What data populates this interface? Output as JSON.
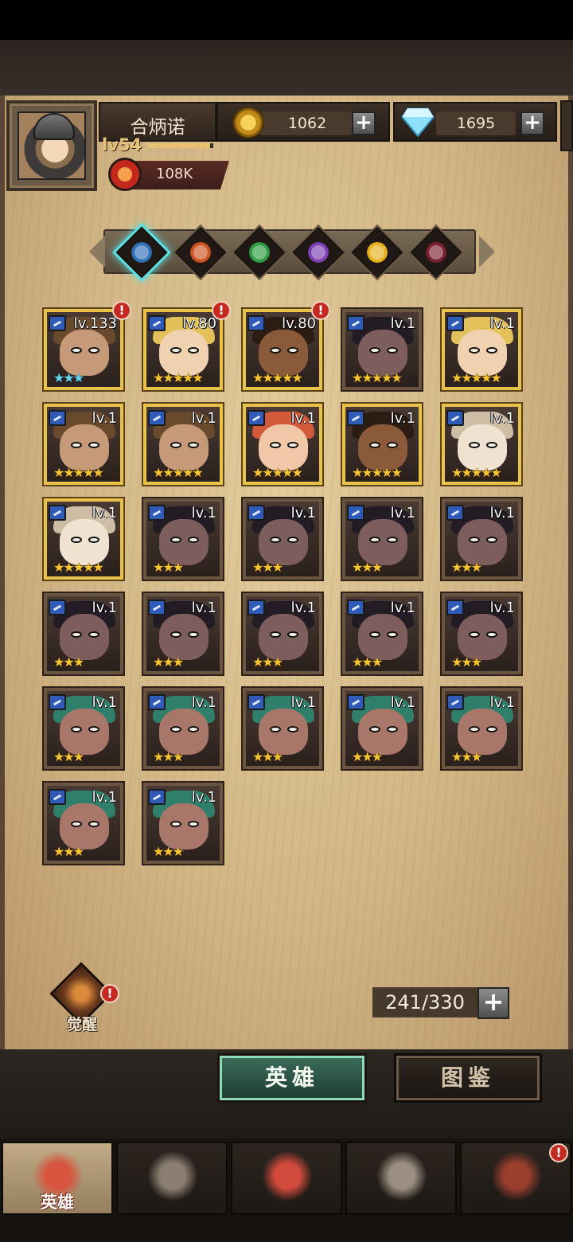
{
  "player": {
    "name": "合炳诺",
    "level": "lv54",
    "xp_fraction": 0.95,
    "power": "108K"
  },
  "resources": {
    "gold": "1062",
    "gems": "1695",
    "add_symbol": "+"
  },
  "factions": [
    {
      "icon": "sword-crest-icon",
      "color": "#2f6fb6",
      "active": true
    },
    {
      "icon": "sun-crest-icon",
      "color": "#c9521f",
      "active": false
    },
    {
      "icon": "clover-crest-icon",
      "color": "#2e9b44",
      "active": false
    },
    {
      "icon": "eye-crest-icon",
      "color": "#7a3fb0",
      "active": false
    },
    {
      "icon": "halo-crest-icon",
      "color": "#e5b11a",
      "active": false
    },
    {
      "icon": "skull-crest-icon",
      "color": "#7a1f2e",
      "active": false
    }
  ],
  "heroes": [
    {
      "level": "lv.133",
      "stars": "★★★",
      "star_color": "blue",
      "frame": "gold",
      "alert": "!",
      "skin": "#c69a78",
      "hair": "#6a4a2c"
    },
    {
      "level": "lv.80",
      "stars": "★★★★★",
      "star_color": "gold",
      "frame": "gold",
      "alert": "!",
      "skin": "#f0d2b0",
      "hair": "#e2c15a"
    },
    {
      "level": "lv.80",
      "stars": "★★★★★",
      "star_color": "gold",
      "frame": "gold",
      "alert": "!",
      "skin": "#8a5a3a",
      "hair": "#2b1c14"
    },
    {
      "level": "lv.1",
      "stars": "★★★★★",
      "star_color": "gold",
      "frame": "bronze",
      "alert": "",
      "skin": "#7d5e5c",
      "hair": "#241c24"
    },
    {
      "level": "lv.1",
      "stars": "★★★★★",
      "star_color": "gold",
      "frame": "gold",
      "alert": "",
      "skin": "#f0d2b0",
      "hair": "#e2c15a"
    },
    {
      "level": "lv.1",
      "stars": "★★★★★",
      "star_color": "gold",
      "frame": "gold",
      "alert": "",
      "skin": "#c69a78",
      "hair": "#6a4a2c"
    },
    {
      "level": "lv.1",
      "stars": "★★★★★",
      "star_color": "gold",
      "frame": "gold",
      "alert": "",
      "skin": "#c69a78",
      "hair": "#6a4a2c"
    },
    {
      "level": "lv.1",
      "stars": "★★★★★",
      "star_color": "gold",
      "frame": "gold",
      "alert": "",
      "skin": "#f0c8a8",
      "hair": "#d25a3a"
    },
    {
      "level": "lv.1",
      "stars": "★★★★★",
      "star_color": "gold",
      "frame": "gold",
      "alert": "",
      "skin": "#8a5a3a",
      "hair": "#2b1c14"
    },
    {
      "level": "lv.1",
      "stars": "★★★★★",
      "star_color": "gold",
      "frame": "gold",
      "alert": "",
      "skin": "#efe2d0",
      "hair": "#cdbda4"
    },
    {
      "level": "lv.1",
      "stars": "★★★★★",
      "star_color": "gold",
      "frame": "gold",
      "alert": "",
      "skin": "#efe2d0",
      "hair": "#cdbda4"
    },
    {
      "level": "lv.1",
      "stars": "★★★",
      "star_color": "gold",
      "frame": "bronze",
      "alert": "",
      "skin": "#7d5e5c",
      "hair": "#241c24"
    },
    {
      "level": "lv.1",
      "stars": "★★★",
      "star_color": "gold",
      "frame": "bronze",
      "alert": "",
      "skin": "#7d5e5c",
      "hair": "#241c24"
    },
    {
      "level": "lv.1",
      "stars": "★★★",
      "star_color": "gold",
      "frame": "bronze",
      "alert": "",
      "skin": "#7d5e5c",
      "hair": "#241c24"
    },
    {
      "level": "lv.1",
      "stars": "★★★",
      "star_color": "gold",
      "frame": "bronze",
      "alert": "",
      "skin": "#7d5e5c",
      "hair": "#241c24"
    },
    {
      "level": "lv.1",
      "stars": "★★★",
      "star_color": "gold",
      "frame": "bronze",
      "alert": "",
      "skin": "#7d5e5c",
      "hair": "#241c24"
    },
    {
      "level": "lv.1",
      "stars": "★★★",
      "star_color": "gold",
      "frame": "bronze",
      "alert": "",
      "skin": "#7d5e5c",
      "hair": "#241c24"
    },
    {
      "level": "lv.1",
      "stars": "★★★",
      "star_color": "gold",
      "frame": "bronze",
      "alert": "",
      "skin": "#7d5e5c",
      "hair": "#241c24"
    },
    {
      "level": "lv.1",
      "stars": "★★★",
      "star_color": "gold",
      "frame": "bronze",
      "alert": "",
      "skin": "#7d5e5c",
      "hair": "#241c24"
    },
    {
      "level": "lv.1",
      "stars": "★★★",
      "star_color": "gold",
      "frame": "bronze",
      "alert": "",
      "skin": "#7d5e5c",
      "hair": "#241c24"
    },
    {
      "level": "lv.1",
      "stars": "★★★",
      "star_color": "gold",
      "frame": "bronze",
      "alert": "",
      "skin": "#a8776a",
      "hair": "#2f7f6a"
    },
    {
      "level": "lv.1",
      "stars": "★★★",
      "star_color": "gold",
      "frame": "bronze",
      "alert": "",
      "skin": "#a8776a",
      "hair": "#2f7f6a"
    },
    {
      "level": "lv.1",
      "stars": "★★★",
      "star_color": "gold",
      "frame": "bronze",
      "alert": "",
      "skin": "#a8776a",
      "hair": "#2f7f6a"
    },
    {
      "level": "lv.1",
      "stars": "★★★",
      "star_color": "gold",
      "frame": "bronze",
      "alert": "",
      "skin": "#a8776a",
      "hair": "#2f7f6a"
    },
    {
      "level": "lv.1",
      "stars": "★★★",
      "star_color": "gold",
      "frame": "bronze",
      "alert": "",
      "skin": "#a8776a",
      "hair": "#2f7f6a"
    },
    {
      "level": "lv.1",
      "stars": "★★★",
      "star_color": "gold",
      "frame": "bronze",
      "alert": "",
      "skin": "#a8776a",
      "hair": "#2f7f6a"
    },
    {
      "level": "lv.1",
      "stars": "★★★",
      "star_color": "gold",
      "frame": "bronze",
      "alert": "",
      "skin": "#a8776a",
      "hair": "#2f7f6a"
    }
  ],
  "awaken": {
    "label": "觉醒",
    "alert": "!"
  },
  "capacity": {
    "text": "241/330",
    "add_symbol": "+"
  },
  "view_tabs": {
    "heroes": "英雄",
    "codex": "图鉴"
  },
  "bottom_nav": [
    {
      "icon": "knight-helmet-icon",
      "label": "英雄",
      "active": true
    },
    {
      "icon": "war-banner-icon",
      "label": "",
      "active": false
    },
    {
      "icon": "crossed-swords-icon",
      "label": "",
      "active": false
    },
    {
      "icon": "castle-tower-icon",
      "label": "",
      "active": false
    },
    {
      "icon": "guild-handshake-icon",
      "label": "",
      "active": false,
      "alert": "!"
    }
  ],
  "colors": {
    "gold_frame": "#e9c24a",
    "bronze_frame": "#6b5540",
    "active_tab": "#8fd9b8",
    "alert": "#c52a20",
    "faction_glow": "#59e2e6"
  }
}
